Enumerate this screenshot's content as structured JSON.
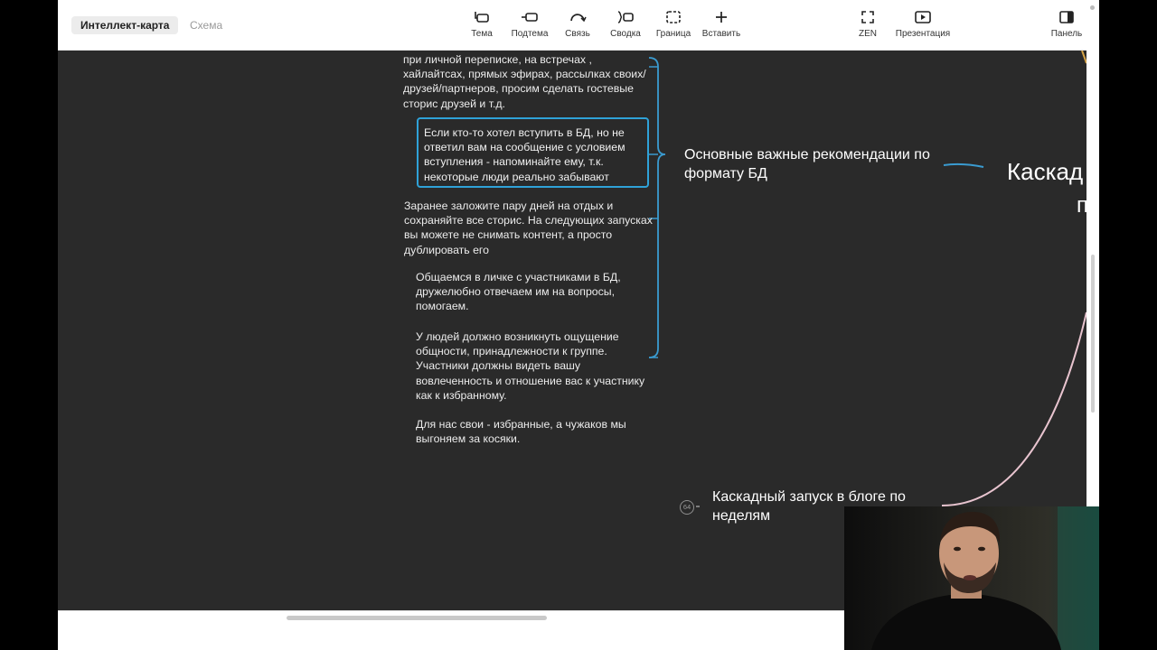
{
  "toolbar": {
    "mode_tabs": [
      "Интеллект-карта",
      "Схема"
    ],
    "tools": [
      {
        "label": "Тема",
        "icon": "topic-icon"
      },
      {
        "label": "Подтема",
        "icon": "subtopic-icon"
      },
      {
        "label": "Связь",
        "icon": "relationship-icon"
      },
      {
        "label": "Сводка",
        "icon": "summary-icon"
      },
      {
        "label": "Граница",
        "icon": "boundary-icon"
      },
      {
        "label": "Вставить",
        "icon": "plus-icon"
      }
    ],
    "right_tools": [
      {
        "label": "ZEN",
        "icon": "fullscreen-icon"
      },
      {
        "label": "Презентация",
        "icon": "play-icon"
      }
    ],
    "panel_label": "Панель"
  },
  "canvas": {
    "notes": [
      "при личной переписке, на встречах , хайлайтсах, прямых эфирах, рассылках своих/друзей/партнеров, просим сделать гостевые сторис друзей и т.д.",
      "Заранее заложите пару дней на отдых и сохраняйте все сторис. На следующих запусках вы можете не снимать контент, а просто дублировать его",
      "Общаемся в личке с участниками в БД, дружелюбно отвечаем им на вопросы, помогаем.",
      " У людей должно возникнуть ощущение общности, принадлежности к группе. Участники должны видеть вашу вовлеченность и отношение вас к участнику как к избранному.",
      "Для нас свои - избранные, а чужаков мы выгоняем за косяки."
    ],
    "selected_note": "Если кто-то хотел вступить в БД, но не ответил вам на сообщение с условием вступления - напоминайте ему, т.к. некоторые люди реально забывают",
    "topic_main": "Основные важные рекомендации по формату БД",
    "topic_cascade": "Каскадный запуск в блоге по неделям",
    "central_partial": "Каскад",
    "central_partial_2": "п",
    "collapsed_count": "64"
  },
  "colors": {
    "canvas_bg": "#2a2a2a",
    "selection": "#2fa2d8",
    "branch_blue": "#3a9bd0",
    "branch_pink": "#e8c4cf"
  }
}
